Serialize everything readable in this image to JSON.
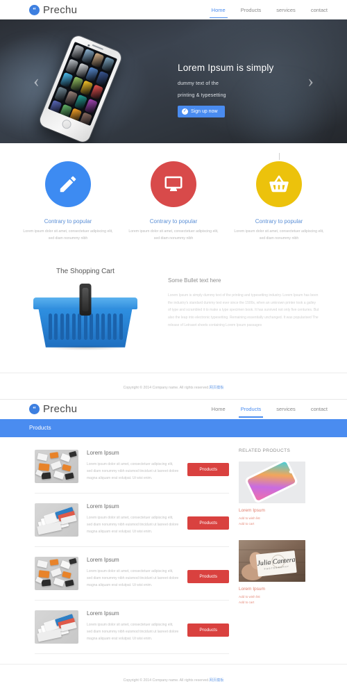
{
  "header": {
    "brand_mark": "quote-icon",
    "brand_name": "Prechu",
    "nav": [
      {
        "label": "Home",
        "active": true
      },
      {
        "label": "Products",
        "active": false
      },
      {
        "label": "services",
        "active": false
      },
      {
        "label": "contact",
        "active": false
      }
    ]
  },
  "hero": {
    "title": "Lorem Ipsum is simply",
    "line2": "dummy text of the",
    "line3": "printing & typesetting",
    "button_label": "Sign up now",
    "button_icon": "check-circle-icon",
    "prev_arrow": "‹",
    "next_arrow": "›",
    "device": "white-smartphone"
  },
  "features": [
    {
      "icon": "pencil-icon",
      "color": "#3d8bf2",
      "title": "Contrary to popular",
      "text": "Lorem ipsum dolor sit amet, consectetuer adipiscing elit, sed diam nonummy nibh"
    },
    {
      "icon": "monitor-icon",
      "color": "#d84a4a",
      "title": "Contrary to popular",
      "text": "Lorem ipsum dolor sit amet, consectetuer adipiscing elit, sed diam nonummy nibh"
    },
    {
      "icon": "basket-icon",
      "color": "#ecc20c",
      "title": "Contrary to popular",
      "text": "Lorem ipsum dolor sit amet, consectetuer adipiscing elit, sed diam nonummy nibh"
    }
  ],
  "cart": {
    "heading": "The Shopping Cart",
    "image": "blue-shopping-basket",
    "bullet_title": "Some Bullet text here",
    "bullet_text": "Lorem Ipsum is simply dummy text of the printing and typesetting industry. Lorem Ipsum has been the industry's standard dummy text ever since the 1500s, when an unknown printer took a galley of type and scrambled it to make a type specimen book. It has survived not only five centuries. But also the leap into electronic typesetting. Remaining essentially unchanged. It was popularised The release of Letraset sheets containing Lorem Ipsum passages"
  },
  "copyright": {
    "text": "Copyright © 2014 Company name. All rights reserved.",
    "cn_link": "网页模板"
  },
  "page2": {
    "nav": [
      {
        "label": "Home",
        "active": false
      },
      {
        "label": "Products",
        "active": true
      },
      {
        "label": "services",
        "active": false
      },
      {
        "label": "contact",
        "active": false
      }
    ],
    "banner_title": "Products",
    "products": [
      {
        "title": "Lorem Ipsum",
        "desc": "Lorem ipsum dolor sit amet, consectetuer adipiscing elit, sed diam nonummy nibh euismod tincidunt ut laoreet dolore magna aliquam erat volutpat. Ut wisi enim.",
        "button": "Products",
        "thumb": "scattered-cards-thumbnail"
      },
      {
        "title": "Lorem Ipsum",
        "desc": "Lorem ipsum dolor sit amet, consectetuer adipiscing elit, sed diam nonummy nibh euismod tincidunt ut laoreet dolore magna aliquam erat volutpat. Ut wisi enim.",
        "button": "Products",
        "thumb": "stacked-cards-thumbnail"
      },
      {
        "title": "Lorem Ipsum",
        "desc": "Lorem ipsum dolor sit amet, consectetuer adipiscing elit, sed diam nonummy nibh euismod tincidunt ut laoreet dolore magna aliquam erat volutpat. Ut wisi enim.",
        "button": "Products",
        "thumb": "scattered-cards-thumbnail"
      },
      {
        "title": "Lorem Ipsum",
        "desc": "Lorem ipsum dolor sit amet, consectetuer adipiscing elit, sed diam nonummy nibh euismod tincidunt ut laoreet dolore magna aliquam erat volutpat. Ut wisi enim.",
        "button": "Products",
        "thumb": "stacked-cards-thumbnail"
      }
    ],
    "related_heading": "RELATED PRODUCTS",
    "related": [
      {
        "title": "Lorem Ipsum",
        "wish": "Add to wish list",
        "cart": "Add to cart",
        "image": "gradient-smartphone"
      },
      {
        "title": "Lorem Ipsum",
        "wish": "Add to wish list",
        "cart": "Add to cart",
        "image": "business-card-julia-cantera",
        "card_name": "Julia Cantera",
        "card_sub": "PHOTOGRAPHY"
      }
    ]
  },
  "colors": {
    "accent_blue": "#4a8cf0",
    "accent_red": "#d9413f",
    "feature_blue": "#3d8bf2",
    "feature_red": "#d84a4a",
    "feature_yellow": "#ecc20c"
  }
}
